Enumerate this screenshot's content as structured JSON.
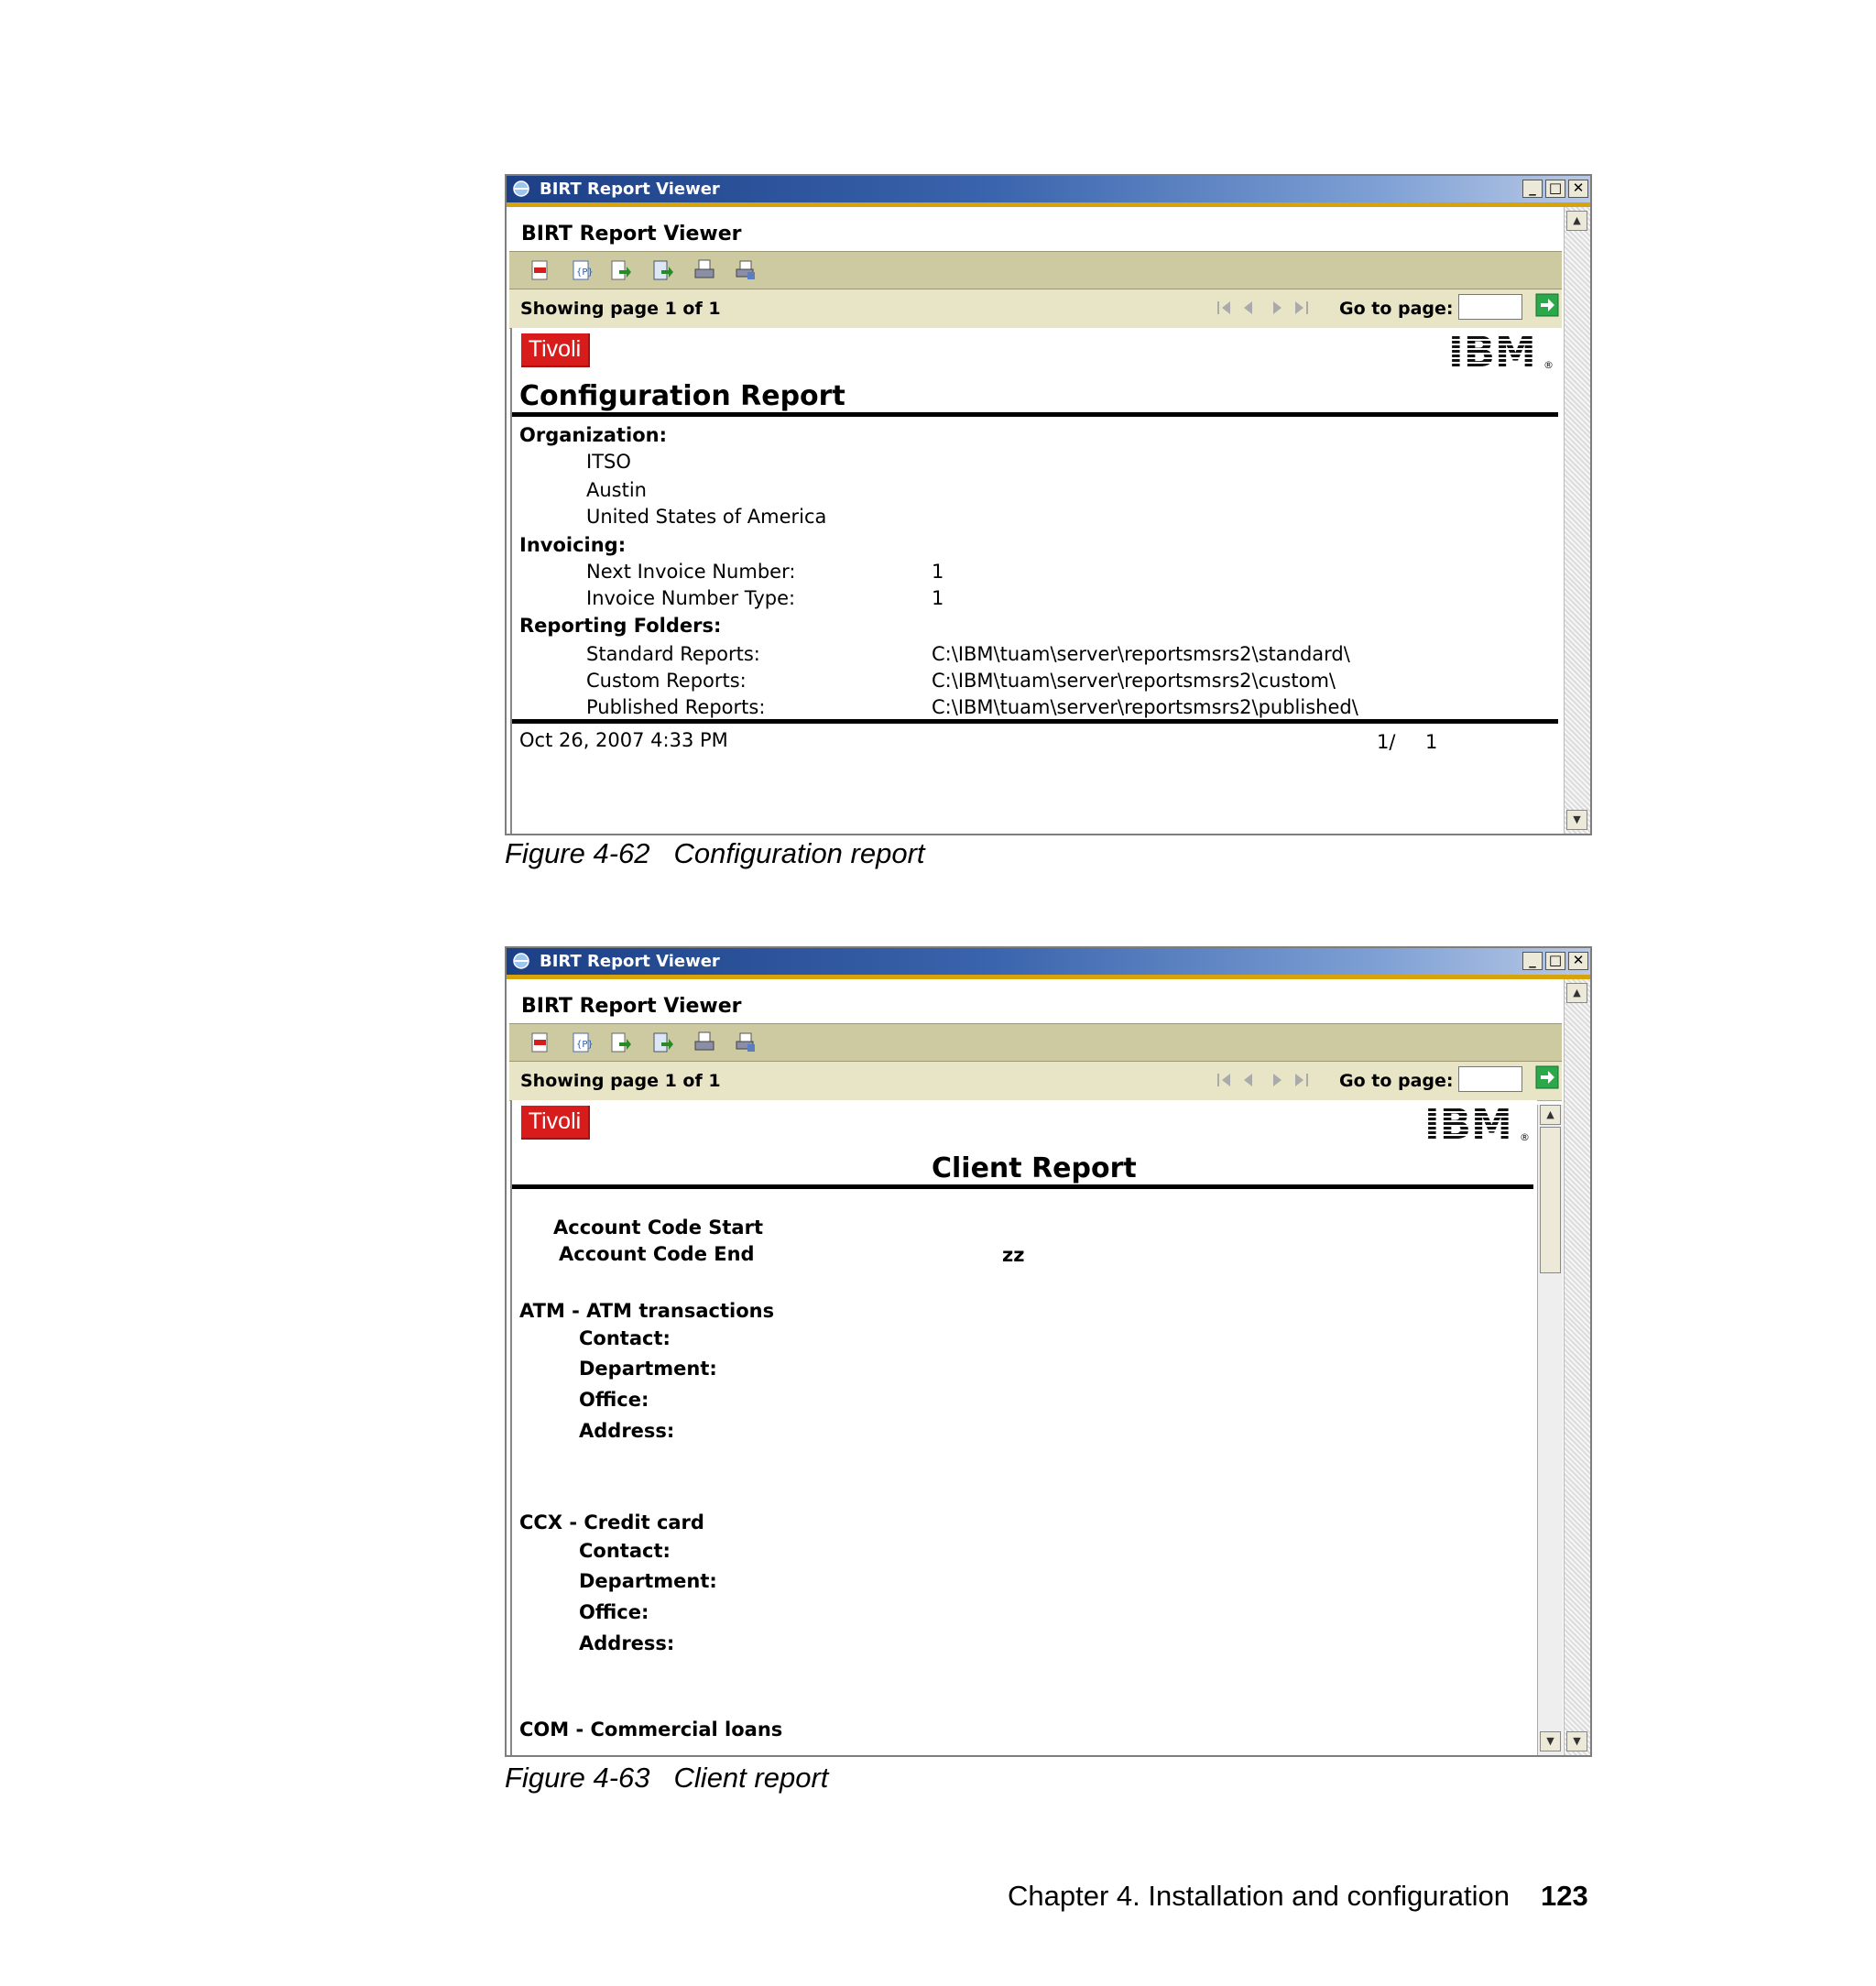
{
  "window_title": "BIRT Report Viewer",
  "window_controls": {
    "minimize": "_",
    "maximize": "□",
    "close": "✕"
  },
  "viewer_header": "BIRT Report Viewer",
  "toolbar_icons": [
    "toc-icon",
    "parameters-icon",
    "export-data-icon",
    "export-report-icon",
    "print-icon",
    "print-server-icon"
  ],
  "navigation": {
    "showing_page": "Showing page  1  of  1",
    "goto_label": "Go to page:",
    "goto_value": ""
  },
  "brand": {
    "tivoli": "Tivoli",
    "ibm": "IBM",
    "registered": "®"
  },
  "config_report": {
    "title": "Configuration Report",
    "organization_label": "Organization:",
    "organization": [
      "ITSO",
      "Austin",
      "United States of America"
    ],
    "invoicing_label": "Invoicing:",
    "invoicing": [
      {
        "label": "Next Invoice Number:",
        "value": "1"
      },
      {
        "label": "Invoice Number Type:",
        "value": "1"
      }
    ],
    "folders_label": "Reporting Folders:",
    "folders": [
      {
        "label": "Standard Reports:",
        "value": "C:\\IBM\\tuam\\server\\reportsmsrs2\\standard\\"
      },
      {
        "label": "Custom Reports:",
        "value": "C:\\IBM\\tuam\\server\\reportsmsrs2\\custom\\"
      },
      {
        "label": "Published Reports:",
        "value": "C:\\IBM\\tuam\\server\\reportsmsrs2\\published\\"
      }
    ],
    "footer_date": "Oct 26, 2007 4:33 PM",
    "footer_page": "1/",
    "footer_total": "1"
  },
  "client_report": {
    "title": "Client Report",
    "account_start_label": "Account Code Start",
    "account_start_value": "",
    "account_end_label": "Account Code End",
    "account_end_value": "zz",
    "sections": [
      {
        "heading": "ATM - ATM transactions",
        "fields": [
          "Contact:",
          "Department:",
          "Office:",
          "Address:"
        ]
      },
      {
        "heading": "CCX - Credit card",
        "fields": [
          "Contact:",
          "Department:",
          "Office:",
          "Address:"
        ]
      }
    ],
    "cut_off_heading": "COM - Commercial loans"
  },
  "captions": {
    "fig1_num": "Figure 4-62",
    "fig1_text": "Configuration report",
    "fig2_num": "Figure 4-63",
    "fig2_text": "Client report"
  },
  "page_footer": {
    "chapter": "Chapter 4. Installation and configuration",
    "page": "123"
  },
  "colors": {
    "tivoli_red": "#d81c1c",
    "toolbar": "#cdc9a1",
    "navbar": "#e8e5c6",
    "accent_gold": "#d6a30a",
    "titlebar_blue": "#1c3f86"
  }
}
